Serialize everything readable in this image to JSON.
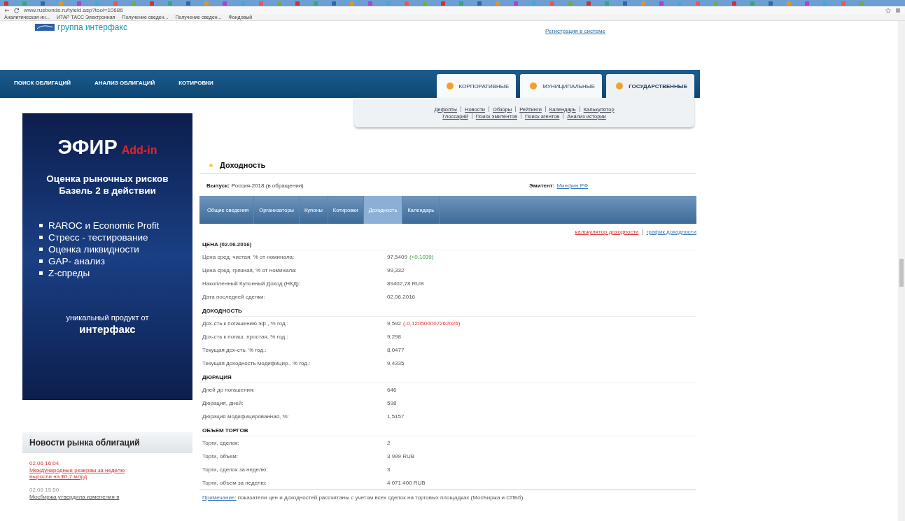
{
  "browser": {
    "url": "www.rusbonds.ru/tyield.asp?tool=10686",
    "bookmarks": [
      "Аналитическая ин...",
      "ИТАР ТАСС Электронная",
      "Получение сведен...",
      "Получение сведен...",
      "Фондовый"
    ]
  },
  "header": {
    "logo": "группа интерфакс",
    "register_link": "Регистрация в системе"
  },
  "nav": {
    "items": [
      "ПОИСК ОБЛИГАЦИЙ",
      "АНАЛИЗ ОБЛИГАЦИЙ",
      "КОТИРОВКИ"
    ],
    "segments": [
      {
        "label": "КОРПОРАТИВНЫЕ",
        "selected": false
      },
      {
        "label": "МУНИЦИПАЛЬНЫЕ",
        "selected": false
      },
      {
        "label": "ГОСУДАРСТВЕННЫЕ",
        "selected": true
      }
    ],
    "sublinks": [
      [
        "Дефолты",
        "Новости",
        "Обзоры",
        "Рейтинги",
        "Календарь",
        "Калькулятор"
      ],
      [
        "Глоссарий",
        "Поиск эмитентов",
        "Поиск агентов",
        "Анализ истории"
      ]
    ]
  },
  "banner": {
    "title": "ЭФИР",
    "title_accent": "Add-in",
    "subtitle": "Оценка рыночных рисков Базель 2 в действии",
    "bullets": [
      "RAROC и Economic Profit",
      "Стресс - тестирование",
      "Оценка ликвидности",
      "GAP- анализ",
      "Z-спреды"
    ],
    "footer": "уникальный продукт от",
    "brand": "интерфакс"
  },
  "news": {
    "title": "Новости рынка облигаций",
    "items": [
      {
        "time": "02.06 16:04",
        "headline": "Международные резервы за неделю выросли на $0,7 млрд",
        "highlighted": true
      },
      {
        "time": "02.06 15:50",
        "headline": "Мосбиржа утвердила изменения в",
        "highlighted": false
      }
    ]
  },
  "main": {
    "title": "Доходность",
    "issue_label": "Выпуск:",
    "issue": "Россия-2018 (в обращении)",
    "issuer_label": "Эмитент:",
    "issuer": "Минфин РФ",
    "tabs": [
      {
        "label": "Общие сведения",
        "selected": false
      },
      {
        "label": "Организаторы",
        "selected": false
      },
      {
        "label": "Купоны",
        "selected": false
      },
      {
        "label": "Котировки",
        "selected": false
      },
      {
        "label": "Доходность",
        "selected": true
      },
      {
        "label": "Календарь",
        "selected": false
      }
    ],
    "links": [
      {
        "label": "калькулятор доходности",
        "kind": "accent"
      },
      {
        "label": "график доходности",
        "kind": "plain"
      }
    ],
    "sections": [
      {
        "title": "ЦЕНА (02.06.2016)",
        "rows": [
          {
            "label": "Цена сред. чистая, % от номинала:",
            "value": "97,5409",
            "change": "(+0,1039)",
            "rising": true
          },
          {
            "label": "Цена сред. грязная, % от номинала:",
            "value": "99,332"
          },
          {
            "label": "Накопленный Купонный Доход (НКД):",
            "value": "89402,78 RUB"
          },
          {
            "label": "Дата последней сделки:",
            "value": "02.06.2016"
          }
        ]
      },
      {
        "title": "ДОХОДНОСТЬ",
        "rows": [
          {
            "label": "Дох-сть к погашению эф., % год.:",
            "value": "9,592",
            "change": "(-0,120500007262026)",
            "rising": false
          },
          {
            "label": "Дох-сть к погаш. простая, % год.:",
            "value": "9,298"
          },
          {
            "label": "Текущая дох-сть, % год.:",
            "value": "8,0477"
          },
          {
            "label": "Текущая доходность модифицир., % год.:",
            "value": "9,4335"
          }
        ]
      },
      {
        "title": "ДЮРАЦИЯ",
        "rows": [
          {
            "label": "Дней до погашения:",
            "value": "646"
          },
          {
            "label": "Дюрация, дней:",
            "value": "598"
          },
          {
            "label": "Дюрация модифицированная, %:",
            "value": "1,5157"
          }
        ]
      },
      {
        "title": "ОБЪЕМ ТОРГОВ",
        "rows": [
          {
            "label": "Торги, сделок:",
            "value": "2"
          },
          {
            "label": "Торги, объем:",
            "value": "3 999 RUB"
          },
          {
            "label": "Торги, сделок за неделю:",
            "value": "3"
          },
          {
            "label": "Торги, объем за неделю:",
            "value": "4 071 400 RUB"
          }
        ]
      }
    ],
    "note_label": "Примечание:",
    "note": "показатели цен и доходностей рассчитаны с учетом всех сделок на торговых площадках (МосБиржа и СПБб)"
  }
}
